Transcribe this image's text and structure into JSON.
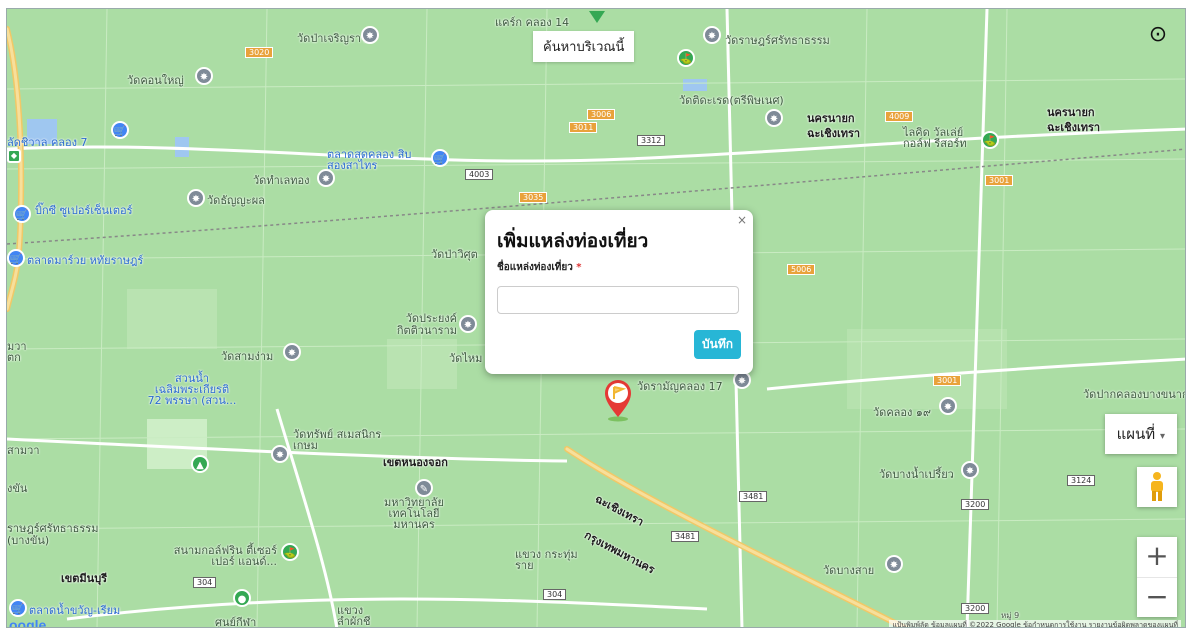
{
  "map": {
    "search_area_label": "ค้นหาบริเวณนี้",
    "map_type_label": "แผนที่",
    "google_logo": "oogle",
    "attribution": "แป้นพิมพ์ลัด  ข้อมูลแผนที่ ©2022 Google  ข้อกำหนดการใช้งาน  รายงานข้อผิดพลาดของแผนที่",
    "zoom_in": "+",
    "zoom_out": "−",
    "place_labels": [
      "แคร์ก คลอง 14",
      "วัดป่าเจริญราช",
      "วัดราษฎร์ศรัทธาธรรม",
      "วัดคอนใหญ่",
      "วัดติดะเรด(ตรีพิษเนศ)",
      "นครนายก",
      "ฉะเชิงเทรา",
      "นครนายก",
      "ฉะเชิงเทรา",
      "ลัดชิวาล คลอง 7",
      "ตลาดสดคลอง สิบสองสาไทร",
      "วัดทำเลทอง",
      "วัดธัญญะผล",
      "ไลคิด วัลเล่ย์ กอล์ฟ รีสอร์ท",
      "บิ๊กซี ซูเปอร์เซ็นเตอร์",
      "ตลาดมาร์วย หทัยราษฎร์",
      "วัดป่าวิศุต",
      "วัดประยงค์ กิตติวนาราม",
      "วัดสามง่าม",
      "วัดไหม",
      "วัดรามัญคลอง 17",
      "วัดปากคลองบางขนาก",
      "วัดคลอง ๑๙",
      "สวนน้ำ เฉลิมพระเกียรติ 72 พรรษา (สวน...",
      "วัดทรัพย์ สเมสนิกรเกษม",
      "เขตหนองจอก",
      "วัดบางน้ำเปรี้ยว",
      "มหาวิทยาลัย เทคโนโลยี มหานคร",
      "ฉะเชิงเทรา",
      "กรุงเทพมหานคร",
      "ราษฎร์ศรัทธาธรรม (บางขัน)",
      "สนามกอล์ฟริน ตี้เซอร์เปอร์ แอนด์...",
      "เขตมีนบุรี",
      "แขวง กระทุ่มราย",
      "วัดบางสาย",
      "ตลาดน้ำขวัญ-เรียม",
      "ศูนย์กีฬา",
      "แขวง ลำผักชี",
      "มวา ตก",
      "สามวา",
      "งขัน"
    ],
    "road_labels": [
      "3020",
      "3006",
      "3011",
      "3312",
      "4009",
      "3001",
      "4003",
      "3035",
      "5006",
      "3001",
      "3481",
      "3481",
      "3200",
      "3124",
      "304",
      "304",
      "3200",
      "หมู่ 9"
    ],
    "colors": {
      "land": "#a9dca3",
      "highway": "#f3d27a",
      "road": "#ffffff",
      "water": "#9fc7f0",
      "accent": "#27b6d6"
    }
  },
  "dialog": {
    "title": "เพิ่มแหล่งท่องเที่ยว",
    "close_label": "×",
    "field_label": "ชื่อแหล่งท่องเที่ยว",
    "required_mark": "*",
    "field_value": "",
    "field_placeholder": "",
    "save_label": "บันทึก"
  }
}
